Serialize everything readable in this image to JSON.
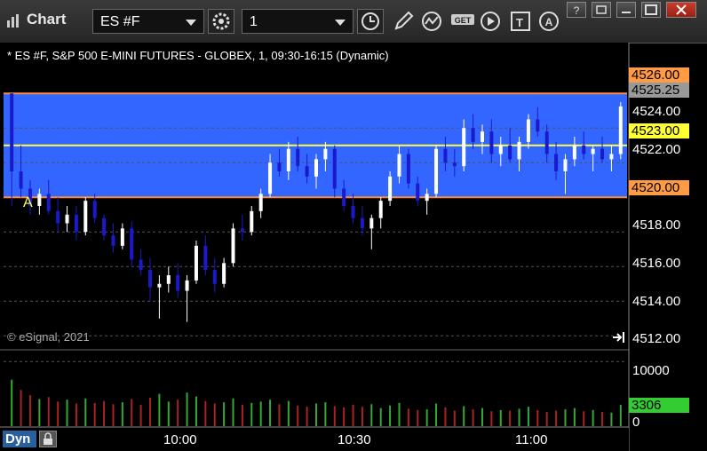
{
  "window": {
    "title": "Chart",
    "symbol": "ES #F",
    "interval": "1"
  },
  "toolbar_icons": [
    "settings-gear-icon",
    "clock-icon",
    "pencil-draw-icon",
    "study-wave-icon",
    "get-data-icon",
    "play-icon",
    "text-tool-icon",
    "alert-icon"
  ],
  "chart": {
    "header": "* ES #F, S&P 500 E-MINI FUTURES - GLOBEX, 1, 09:30-16:15 (Dynamic)",
    "watermark": "© eSignal, 2021",
    "marker": "A",
    "dyn_label": "Dyn"
  },
  "price_axis": {
    "labels": [
      "4524.00",
      "4522.00",
      "4518.00",
      "4516.00",
      "4514.00",
      "4512.00"
    ],
    "tag_high": "4526.00",
    "tag_last": "4525.25",
    "tag_mid": "4523.00",
    "tag_low": "4520.00"
  },
  "volume_axis": {
    "label_top": "10000",
    "label_zero": "0",
    "tag_current": "3306"
  },
  "time_axis": [
    "10:00",
    "10:30",
    "11:00"
  ],
  "colors": {
    "zone": "#3366ff",
    "up": "#ffffff",
    "down": "#1a1acc",
    "level_line": "#ffff44",
    "boundary_line": "#ff8c3a",
    "vol_up": "#33aa33",
    "vol_down": "#aa2222"
  },
  "chart_data": {
    "type": "candlestick",
    "ylim": [
      4511.5,
      4527.5
    ],
    "zone": [
      4520.0,
      4526.0
    ],
    "level": 4523.0,
    "candles": [
      [
        4526.0,
        4526.0,
        4519.5,
        4521.5
      ],
      [
        4521.5,
        4523.0,
        4520.0,
        4520.5
      ],
      [
        4520.5,
        4521.0,
        4519.0,
        4519.5
      ],
      [
        4519.5,
        4520.5,
        4519.0,
        4520.2
      ],
      [
        4520.2,
        4521.0,
        4519.0,
        4519.2
      ],
      [
        4519.2,
        4520.0,
        4518.0,
        4518.5
      ],
      [
        4518.5,
        4519.5,
        4518.0,
        4519.0
      ],
      [
        4519.0,
        4519.5,
        4517.5,
        4518.0
      ],
      [
        4518.0,
        4520.0,
        4517.8,
        4519.8
      ],
      [
        4519.8,
        4520.2,
        4518.5,
        4518.8
      ],
      [
        4518.8,
        4519.0,
        4517.5,
        4517.8
      ],
      [
        4517.8,
        4518.5,
        4516.8,
        4517.2
      ],
      [
        4517.2,
        4518.5,
        4517.0,
        4518.2
      ],
      [
        4518.2,
        4518.6,
        4516.0,
        4516.4
      ],
      [
        4516.4,
        4517.0,
        4515.5,
        4515.8
      ],
      [
        4515.8,
        4516.5,
        4514.0,
        4514.8
      ],
      [
        4514.8,
        4515.5,
        4513.0,
        4515.0
      ],
      [
        4515.0,
        4516.0,
        4514.5,
        4515.5
      ],
      [
        4515.5,
        4516.2,
        4514.2,
        4514.6
      ],
      [
        4514.6,
        4515.5,
        4512.8,
        4515.2
      ],
      [
        4515.2,
        4517.5,
        4515.0,
        4517.2
      ],
      [
        4517.2,
        4517.8,
        4515.5,
        4515.8
      ],
      [
        4515.8,
        4516.5,
        4514.5,
        4515.0
      ],
      [
        4515.0,
        4516.5,
        4514.8,
        4516.2
      ],
      [
        4516.2,
        4518.5,
        4516.0,
        4518.2
      ],
      [
        4518.2,
        4519.0,
        4517.5,
        4518.0
      ],
      [
        4518.0,
        4519.5,
        4517.8,
        4519.2
      ],
      [
        4519.2,
        4520.5,
        4518.8,
        4520.2
      ],
      [
        4520.2,
        4522.5,
        4520.0,
        4522.0
      ],
      [
        4522.0,
        4522.8,
        4521.2,
        4521.5
      ],
      [
        4521.5,
        4523.2,
        4521.0,
        4522.8
      ],
      [
        4522.8,
        4523.5,
        4521.5,
        4521.8
      ],
      [
        4521.8,
        4522.5,
        4520.8,
        4521.2
      ],
      [
        4521.2,
        4522.5,
        4520.5,
        4522.2
      ],
      [
        4522.2,
        4523.2,
        4521.5,
        4522.8
      ],
      [
        4522.8,
        4523.0,
        4520.0,
        4520.5
      ],
      [
        4520.5,
        4521.0,
        4519.2,
        4519.5
      ],
      [
        4519.5,
        4520.2,
        4518.5,
        4518.8
      ],
      [
        4518.8,
        4519.5,
        4517.8,
        4518.2
      ],
      [
        4518.2,
        4519.0,
        4517.0,
        4518.8
      ],
      [
        4518.8,
        4520.0,
        4518.2,
        4519.8
      ],
      [
        4519.8,
        4521.5,
        4519.5,
        4521.2
      ],
      [
        4521.2,
        4523.0,
        4520.8,
        4522.5
      ],
      [
        4522.5,
        4522.8,
        4520.5,
        4520.8
      ],
      [
        4520.8,
        4521.2,
        4519.5,
        4519.8
      ],
      [
        4519.8,
        4520.5,
        4519.0,
        4520.2
      ],
      [
        4520.2,
        4523.0,
        4520.0,
        4522.8
      ],
      [
        4522.8,
        4523.5,
        4521.5,
        4522.0
      ],
      [
        4522.0,
        4522.8,
        4521.2,
        4521.8
      ],
      [
        4521.8,
        4524.5,
        4521.5,
        4524.0
      ],
      [
        4524.0,
        4524.8,
        4522.8,
        4523.2
      ],
      [
        4523.2,
        4524.2,
        4522.5,
        4523.8
      ],
      [
        4523.8,
        4524.5,
        4522.0,
        4522.5
      ],
      [
        4522.5,
        4523.5,
        4521.8,
        4523.0
      ],
      [
        4523.0,
        4524.0,
        4522.0,
        4522.2
      ],
      [
        4522.2,
        4523.5,
        4521.5,
        4523.2
      ],
      [
        4523.2,
        4524.8,
        4522.8,
        4524.5
      ],
      [
        4524.5,
        4525.2,
        4523.5,
        4523.8
      ],
      [
        4523.8,
        4524.2,
        4522.0,
        4522.5
      ],
      [
        4522.5,
        4523.2,
        4521.0,
        4521.5
      ],
      [
        4521.5,
        4522.5,
        4520.2,
        4522.2
      ],
      [
        4522.2,
        4523.5,
        4521.8,
        4523.0
      ],
      [
        4523.0,
        4523.8,
        4522.2,
        4522.5
      ],
      [
        4522.5,
        4523.0,
        4521.5,
        4522.8
      ],
      [
        4522.8,
        4523.5,
        4522.0,
        4522.2
      ],
      [
        4522.2,
        4523.0,
        4521.5,
        4522.5
      ],
      [
        4522.5,
        4525.5,
        4522.2,
        4525.25
      ]
    ],
    "volume": [
      [
        7200,
        0
      ],
      [
        5600,
        1
      ],
      [
        4800,
        1
      ],
      [
        4200,
        0
      ],
      [
        4500,
        1
      ],
      [
        3800,
        1
      ],
      [
        4100,
        0
      ],
      [
        3500,
        1
      ],
      [
        4300,
        0
      ],
      [
        3600,
        1
      ],
      [
        3900,
        1
      ],
      [
        3400,
        1
      ],
      [
        3700,
        0
      ],
      [
        4200,
        1
      ],
      [
        3300,
        1
      ],
      [
        4400,
        1
      ],
      [
        5000,
        0
      ],
      [
        3800,
        0
      ],
      [
        4100,
        1
      ],
      [
        5200,
        0
      ],
      [
        4600,
        0
      ],
      [
        3900,
        1
      ],
      [
        3500,
        1
      ],
      [
        3700,
        0
      ],
      [
        4300,
        0
      ],
      [
        3300,
        1
      ],
      [
        3600,
        0
      ],
      [
        3800,
        0
      ],
      [
        4100,
        0
      ],
      [
        3400,
        1
      ],
      [
        3900,
        0
      ],
      [
        3200,
        1
      ],
      [
        3000,
        1
      ],
      [
        3500,
        0
      ],
      [
        3700,
        0
      ],
      [
        3100,
        1
      ],
      [
        2900,
        1
      ],
      [
        3300,
        1
      ],
      [
        3000,
        1
      ],
      [
        3400,
        0
      ],
      [
        2800,
        0
      ],
      [
        3200,
        0
      ],
      [
        3600,
        0
      ],
      [
        2700,
        1
      ],
      [
        2500,
        1
      ],
      [
        2600,
        0
      ],
      [
        3500,
        0
      ],
      [
        2900,
        1
      ],
      [
        2400,
        1
      ],
      [
        3100,
        0
      ],
      [
        2600,
        1
      ],
      [
        2800,
        0
      ],
      [
        2300,
        1
      ],
      [
        2500,
        0
      ],
      [
        2400,
        1
      ],
      [
        2700,
        0
      ],
      [
        3000,
        0
      ],
      [
        2500,
        1
      ],
      [
        2200,
        1
      ],
      [
        2400,
        1
      ],
      [
        2600,
        0
      ],
      [
        2800,
        0
      ],
      [
        2300,
        1
      ],
      [
        2500,
        0
      ],
      [
        2200,
        1
      ],
      [
        2100,
        0
      ],
      [
        3306,
        0
      ]
    ]
  }
}
